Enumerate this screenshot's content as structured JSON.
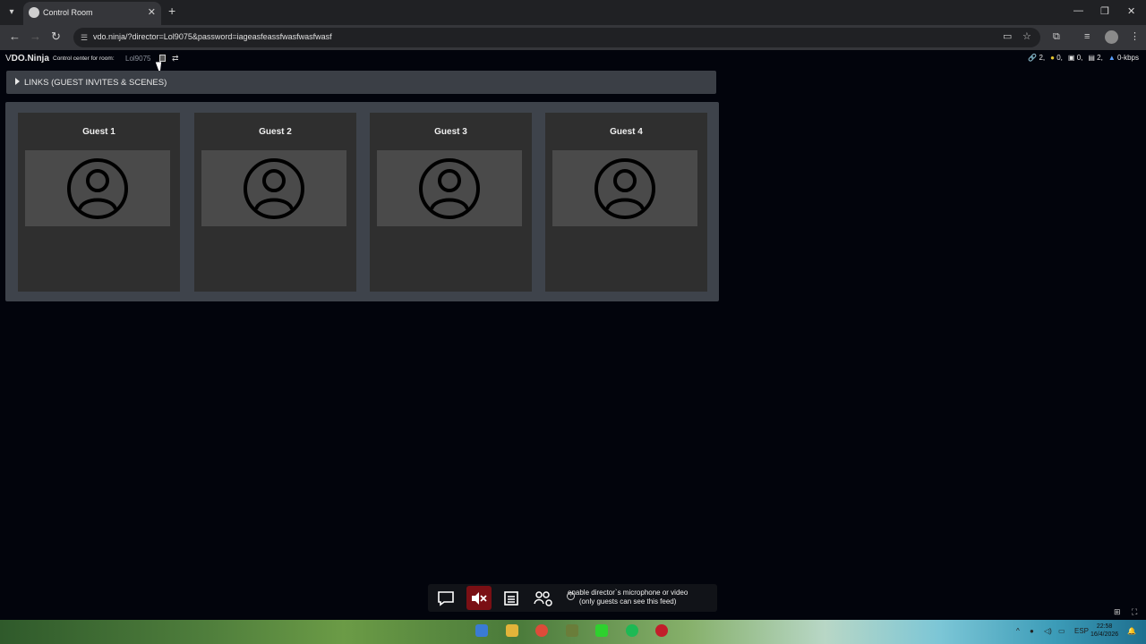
{
  "browser": {
    "tab_title": "Control Room",
    "url": "vdo.ninja/?director=Lol9075&password=iageasfeassfwasfwasfwasf"
  },
  "app": {
    "brand_prefix": "V",
    "brand_name": "DO.Ninja",
    "room_label": "Control center for room:",
    "room_name": "Lol9075",
    "stats": {
      "links": "2,",
      "bulbs": "0,",
      "boxes": "0,",
      "layers": "2,",
      "bitrate": "0-kbps"
    }
  },
  "links_section": {
    "label": "LINKS (GUEST INVITES & SCENES)"
  },
  "guests": [
    {
      "title": "Guest 1"
    },
    {
      "title": "Guest 2"
    },
    {
      "title": "Guest 3"
    },
    {
      "title": "Guest 4"
    }
  ],
  "controls": {
    "enable_line1": "enable director`s microphone or video",
    "enable_line2": "(only guests can see this feed)"
  },
  "taskbar": {
    "time": "22:58",
    "date": "16/4/2026",
    "lang": "ESP"
  },
  "colors": {
    "background": "#02040c",
    "panel": "#3e434b",
    "card": "#2f2f2f",
    "mute_red": "#7a0f14"
  }
}
